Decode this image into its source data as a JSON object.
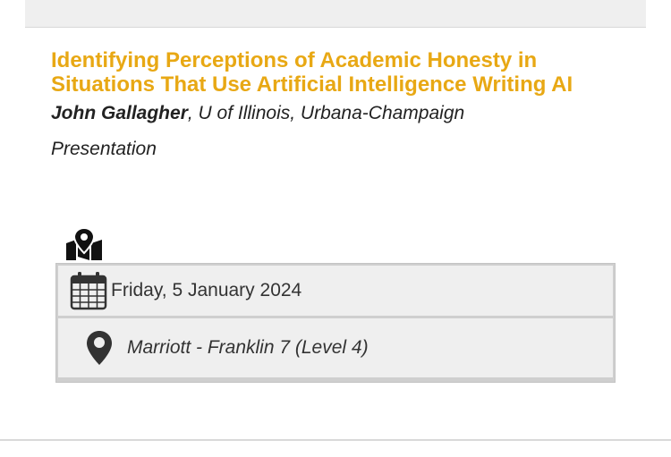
{
  "session": {
    "title": "Identifying Perceptions of Academic Honesty in Situations That Use Artificial Intelligence Writing AI",
    "author_name": "John Gallagher",
    "author_affiliation": ", U of Illinois, Urbana-Champaign",
    "type": "Presentation"
  },
  "details": {
    "date": "Friday, 5 January 2024",
    "location": "Marriott - Franklin 7 (Level 4)"
  },
  "icons": {
    "map": "map-location-icon",
    "calendar": "calendar-icon",
    "pin": "map-pin-icon"
  },
  "colors": {
    "title": "#e8a814",
    "panel": "#efefef"
  }
}
